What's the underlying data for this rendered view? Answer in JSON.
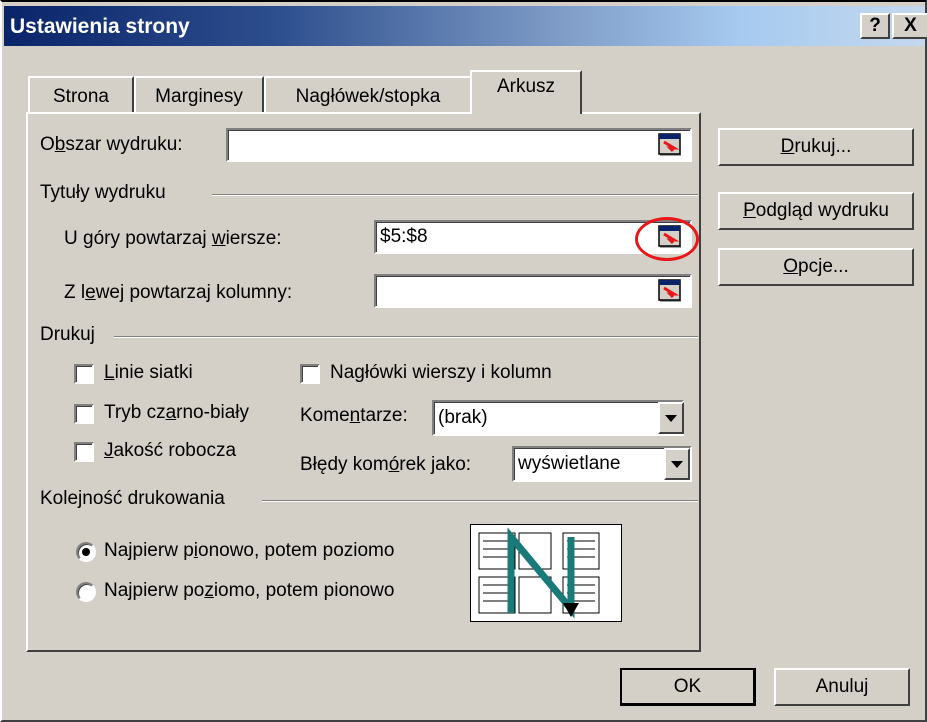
{
  "window": {
    "title": "Ustawienia strony",
    "help_glyph": "?",
    "close_glyph": "X"
  },
  "tabs": [
    {
      "label": "Strona"
    },
    {
      "label": "Marginesy"
    },
    {
      "label": "Nagłówek/stopka"
    },
    {
      "label": "Arkusz",
      "active": true
    }
  ],
  "print_area": {
    "label_pre": "O",
    "label_mnemonic": "b",
    "label_post": "szar wydruku:",
    "value": ""
  },
  "print_titles": {
    "group_label": "Tytuły wydruku",
    "rows_label_pre": "U góry powtarzaj ",
    "rows_label_mnemonic": "w",
    "rows_label_post": "iersze:",
    "rows_value": "$5:$8",
    "cols_label_pre": "Z l",
    "cols_label_mnemonic": "e",
    "cols_label_post": "wej powtarzaj kolumny:",
    "cols_value": ""
  },
  "print": {
    "group_label": "Drukuj",
    "gridlines": {
      "mnemonic": "L",
      "rest": "inie siatki",
      "checked": false
    },
    "bw": {
      "pre": "Tryb cz",
      "mnemonic": "a",
      "post": "rno-biały",
      "checked": false
    },
    "draft": {
      "mnemonic": "J",
      "rest": "akość robocza",
      "checked": false
    },
    "headings": {
      "pre": "Na",
      "mnemonic": "g",
      "post": "łówki wierszy i kolumn",
      "checked": false
    },
    "comments": {
      "pre": "Kome",
      "mnemonic": "n",
      "post": "tarze:",
      "value": "(brak)"
    },
    "errors": {
      "pre": "Błędy kom",
      "mnemonic": "ó",
      "post": "rek jako:",
      "value": "wyświetlane"
    }
  },
  "page_order": {
    "group_label": "Kolejność drukowania",
    "down_then_over": {
      "pre": "Najpierw p",
      "mnemonic": "i",
      "post": "onowo, potem poziomo",
      "selected": true
    },
    "over_then_down": {
      "pre": "Najpierw po",
      "mnemonic": "z",
      "post": "iomo, potem pionowo",
      "selected": false
    }
  },
  "side_buttons": {
    "print": {
      "mnemonic": "D",
      "rest": "rukuj..."
    },
    "preview": {
      "mnemonic": "P",
      "rest": "odgląd wydruku"
    },
    "options": {
      "mnemonic": "O",
      "rest": "pcje..."
    }
  },
  "footer": {
    "ok": "OK",
    "cancel": "Anuluj"
  },
  "colors": {
    "title_start": "#0a246a",
    "title_end": "#a6caf0",
    "face": "#d4d0c8",
    "highlight": "#e8181a",
    "arrow": "#1a7a7a"
  }
}
